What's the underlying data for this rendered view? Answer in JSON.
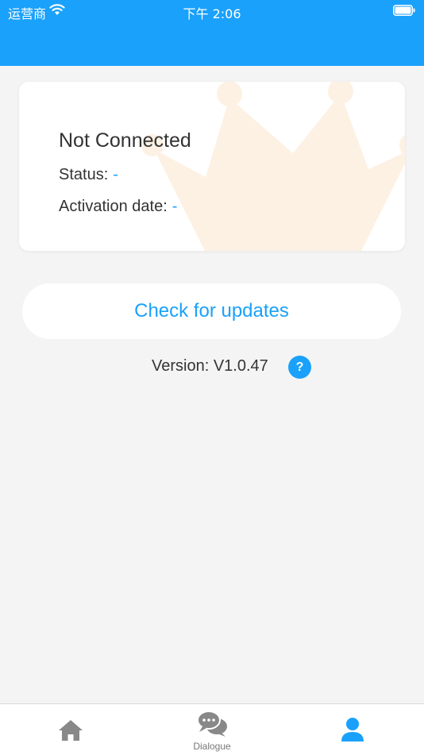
{
  "status_bar": {
    "carrier": "运营商",
    "time": "下午 2:06"
  },
  "card": {
    "title": "Not Connected",
    "status_label": "Status:",
    "status_value": "-",
    "activation_label": "Activation date:",
    "activation_value": "-"
  },
  "update": {
    "button_label": "Check for updates",
    "version_text": "Version: V1.0.47",
    "help_glyph": "?"
  },
  "tabbar": {
    "tabs": [
      {
        "icon": "home-icon",
        "label": ""
      },
      {
        "icon": "chat-bubbles-icon",
        "label": "Dialogue"
      },
      {
        "icon": "user-icon",
        "label": ""
      }
    ],
    "active_index": 2
  },
  "colors": {
    "accent": "#1aa1fb",
    "background": "#f4f4f4",
    "icon_inactive": "#888888"
  }
}
